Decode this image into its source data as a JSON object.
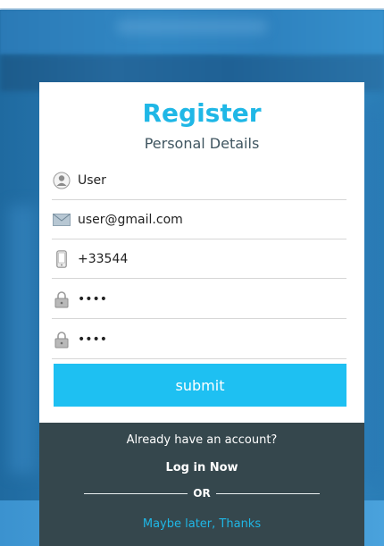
{
  "register": {
    "title": "Register",
    "subtitle": "Personal Details"
  },
  "fields": [
    {
      "icon": "user-icon",
      "value": "User"
    },
    {
      "icon": "envelope-icon",
      "value": "user@gmail.com"
    },
    {
      "icon": "phone-icon",
      "value": "+33544"
    },
    {
      "icon": "lock-icon",
      "value": "••••"
    },
    {
      "icon": "lock-icon",
      "value": "••••"
    }
  ],
  "submit_label": "submit",
  "footer": {
    "already": "Already have an account?",
    "login": "Log in Now",
    "or": "OR",
    "later": "Maybe later, Thanks"
  },
  "colors": {
    "accent": "#1fb7e6",
    "button": "#1ec0f2",
    "footer_bg": "#35474d"
  }
}
